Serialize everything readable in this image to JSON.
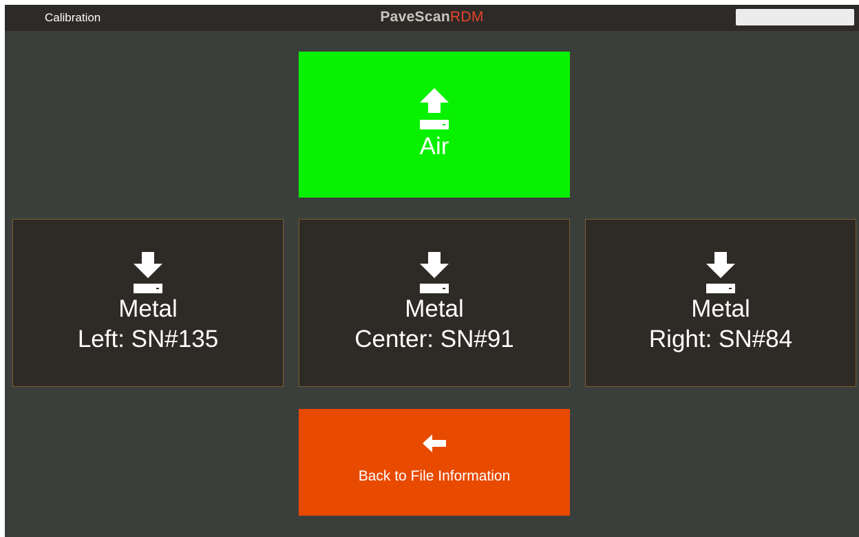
{
  "header": {
    "screen_title": "Calibration",
    "brand_main": "PaveScan",
    "brand_accent": "RDM",
    "brand_accent_color": "#e8432a"
  },
  "tiles": {
    "air": {
      "icon": "upload-icon",
      "label": "Air",
      "color": "#08f100"
    },
    "metal_left": {
      "icon": "download-icon",
      "label": "Metal",
      "sublabel": "Left: SN#135"
    },
    "metal_center": {
      "icon": "download-icon",
      "label": "Metal",
      "sublabel": "Center: SN#91"
    },
    "metal_right": {
      "icon": "download-icon",
      "label": "Metal",
      "sublabel": "Right: SN#84"
    },
    "back": {
      "icon": "arrow-left-icon",
      "label": "Back to File Information",
      "color": "#e84a00"
    }
  }
}
